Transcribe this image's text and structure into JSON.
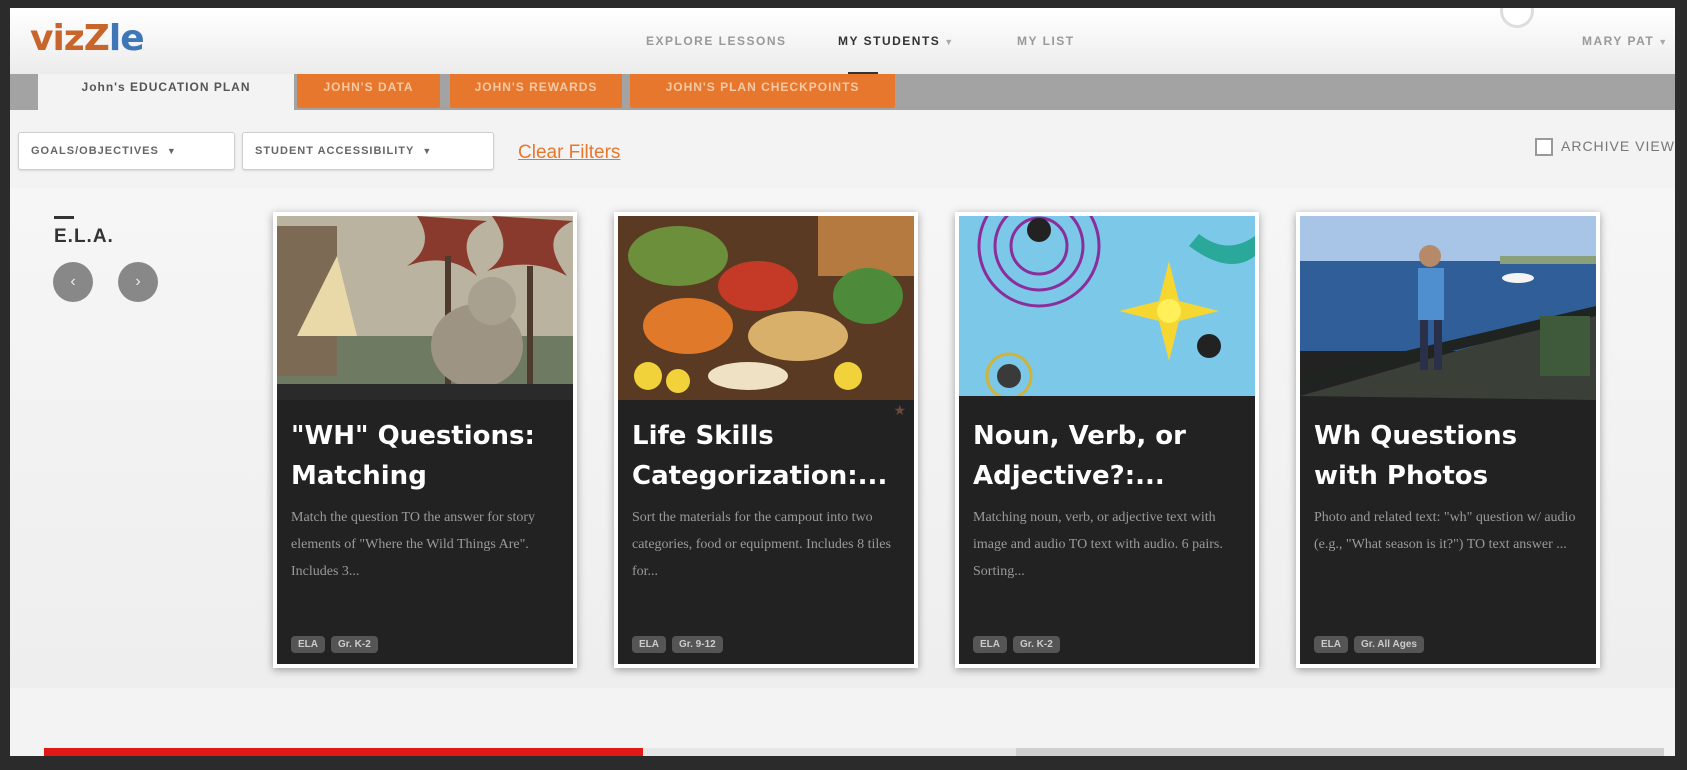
{
  "app": {
    "logo_part1": "vizZ",
    "logo_part2": "le"
  },
  "nav": {
    "explore": "EXPLORE LESSONS",
    "students": "MY STUDENTS",
    "list": "MY LIST",
    "user": "MARY PAT"
  },
  "tabs": [
    {
      "label": "John's EDUCATION PLAN"
    },
    {
      "label": "JOHN'S DATA"
    },
    {
      "label": "JOHN'S REWARDS"
    },
    {
      "label": "JOHN'S PLAN CHECKPOINTS"
    }
  ],
  "filters": {
    "goals": "GOALS/OBJECTIVES",
    "accessibility": "STUDENT ACCESSIBILITY",
    "clear": "Clear Filters",
    "archive": "ARCHIVE VIEW"
  },
  "subject": {
    "label": "E.L.A."
  },
  "cards": [
    {
      "title": "\"WH\" Questions: Matching",
      "description": "Match the question TO the answer for story elements of \"Where the Wild Things Are\". Includes 3...",
      "tags": [
        "ELA",
        "Gr. K-2"
      ]
    },
    {
      "title": "Life Skills Categorization:...",
      "description": "Sort the materials for the campout into two categories, food or equipment. Includes 8 tiles for...",
      "tags": [
        "ELA",
        "Gr. 9-12"
      ]
    },
    {
      "title": "Noun, Verb, or Adjective?:...",
      "description": "Matching noun, verb, or adjective text with image and audio TO text with audio. 6 pairs. Sorting...",
      "tags": [
        "ELA",
        "Gr. K-2"
      ]
    },
    {
      "title": "Wh Questions with Photos",
      "description": "Photo and related text: \"wh\" question w/ audio (e.g., \"What season is it?\") TO text answer ...",
      "tags": [
        "ELA",
        "Gr. All Ages"
      ]
    }
  ],
  "video": {
    "progress": 0.37,
    "buffered": 0.6
  }
}
